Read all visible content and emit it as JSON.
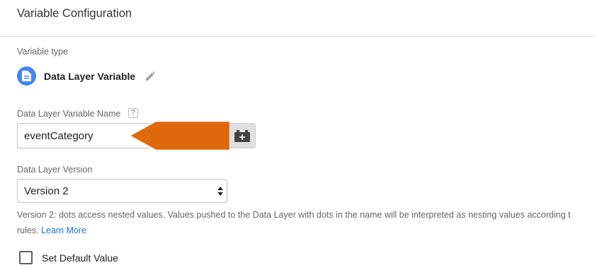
{
  "header": {
    "title": "Variable Configuration"
  },
  "variable_type": {
    "section_label": "Variable type",
    "name": "Data Layer Variable",
    "icon": "document-icon",
    "edit_icon": "pencil-icon"
  },
  "dlv_name": {
    "label": "Data Layer Variable Name",
    "help": "?",
    "value": "eventCategory",
    "picker_icon": "add-variable-icon"
  },
  "dl_version": {
    "label": "Data Layer Version",
    "selected": "Version 2",
    "help_line1": "Version 2: dots access nested values. Values pushed to the Data Layer with dots in the name will be interpreted as nesting values according t",
    "help_line2": "rules.",
    "learn_more": "Learn More"
  },
  "default_value": {
    "label": "Set Default Value",
    "checked": false
  },
  "colors": {
    "accent_blue": "#4285f4",
    "link_blue": "#1a73e8",
    "annotation_arrow": "#e0690e"
  }
}
